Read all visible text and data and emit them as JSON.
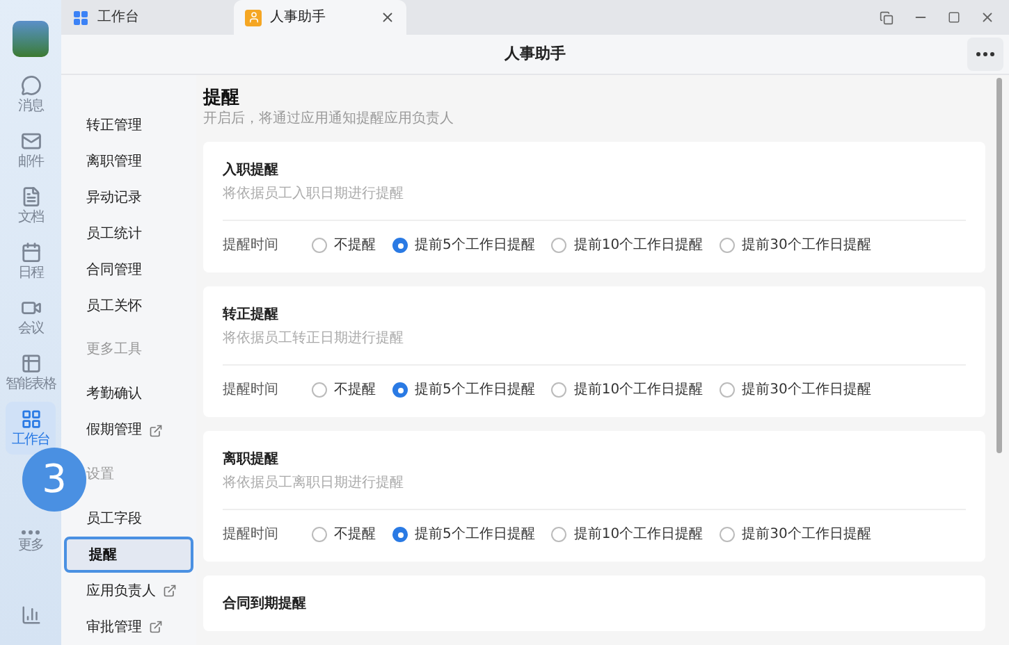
{
  "tabs": [
    {
      "label": "工作台",
      "selected": false,
      "closable": false
    },
    {
      "label": "人事助手",
      "selected": true,
      "closable": true
    }
  ],
  "rail": {
    "items": [
      {
        "label": "消息",
        "selected": false
      },
      {
        "label": "邮件",
        "selected": false
      },
      {
        "label": "文档",
        "selected": false
      },
      {
        "label": "日程",
        "selected": false
      },
      {
        "label": "会议",
        "selected": false
      },
      {
        "label": "智能表格",
        "selected": false
      },
      {
        "label": "工作台",
        "selected": true
      },
      {
        "label": "更多",
        "selected": false
      }
    ]
  },
  "header": {
    "title": "人事助手"
  },
  "nav": {
    "items": [
      {
        "kind": "item",
        "label": "转正管理",
        "selected": false,
        "external": false
      },
      {
        "kind": "item",
        "label": "离职管理",
        "selected": false,
        "external": false
      },
      {
        "kind": "item",
        "label": "异动记录",
        "selected": false,
        "external": false
      },
      {
        "kind": "item",
        "label": "员工统计",
        "selected": false,
        "external": false
      },
      {
        "kind": "item",
        "label": "合同管理",
        "selected": false,
        "external": false
      },
      {
        "kind": "item",
        "label": "员工关怀",
        "selected": false,
        "external": false
      },
      {
        "kind": "section",
        "label": "更多工具"
      },
      {
        "kind": "item",
        "label": "考勤确认",
        "selected": false,
        "external": false
      },
      {
        "kind": "item",
        "label": "假期管理",
        "selected": false,
        "external": true
      },
      {
        "kind": "section",
        "label": "设置"
      },
      {
        "kind": "item",
        "label": "员工字段",
        "selected": false,
        "external": false
      },
      {
        "kind": "item",
        "label": "提醒",
        "selected": true,
        "external": false
      },
      {
        "kind": "item",
        "label": "应用负责人",
        "selected": false,
        "external": true
      },
      {
        "kind": "item",
        "label": "审批管理",
        "selected": false,
        "external": true
      }
    ]
  },
  "page": {
    "title": "提醒",
    "subtitle": "开启后，将通过应用通知提醒应用负责人",
    "cards": [
      {
        "title": "入职提醒",
        "description": "将依据员工入职日期进行提醒",
        "field_label": "提醒时间",
        "options": [
          {
            "label": "不提醒",
            "selected": false
          },
          {
            "label": "提前5个工作日提醒",
            "selected": true
          },
          {
            "label": "提前10个工作日提醒",
            "selected": false
          },
          {
            "label": "提前30个工作日提醒",
            "selected": false
          }
        ]
      },
      {
        "title": "转正提醒",
        "description": "将依据员工转正日期进行提醒",
        "field_label": "提醒时间",
        "options": [
          {
            "label": "不提醒",
            "selected": false
          },
          {
            "label": "提前5个工作日提醒",
            "selected": true
          },
          {
            "label": "提前10个工作日提醒",
            "selected": false
          },
          {
            "label": "提前30个工作日提醒",
            "selected": false
          }
        ]
      },
      {
        "title": "离职提醒",
        "description": "将依据员工离职日期进行提醒",
        "field_label": "提醒时间",
        "options": [
          {
            "label": "不提醒",
            "selected": false
          },
          {
            "label": "提前5个工作日提醒",
            "selected": true
          },
          {
            "label": "提前10个工作日提醒",
            "selected": false
          },
          {
            "label": "提前30个工作日提醒",
            "selected": false
          }
        ]
      },
      {
        "title": "合同到期提醒"
      }
    ]
  },
  "step_badge": "3"
}
